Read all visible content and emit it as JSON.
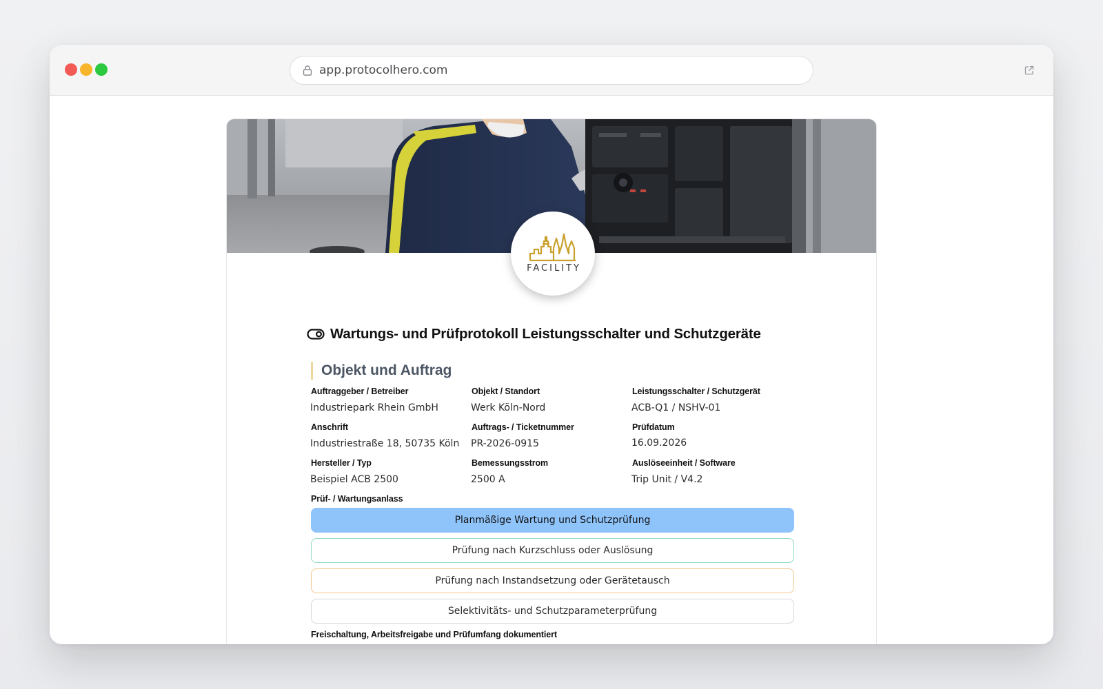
{
  "browser": {
    "url": "app.protocolhero.com"
  },
  "logo": {
    "text": "FACILITY",
    "brand_color": "#c9a02c"
  },
  "document": {
    "title": "Wartungs- und Prüfprotokoll Leistungsschalter und Schutzgeräte"
  },
  "section": {
    "title": "Objekt und Auftrag",
    "accent_color": "#ecd7a1",
    "fields": [
      {
        "label": "Auftraggeber / Betreiber",
        "value": "Industriepark Rhein GmbH"
      },
      {
        "label": "Objekt / Standort",
        "value": "Werk Köln-Nord"
      },
      {
        "label": "Leistungsschalter / Schutzgerät",
        "value": "ACB-Q1 / NSHV-01"
      },
      {
        "label": "Anschrift",
        "value": "Industriestraße 18, 50735 Köln"
      },
      {
        "label": "Auftrags- / Ticketnummer",
        "value": "PR-2026-0915"
      },
      {
        "label": "Prüfdatum",
        "value": "16.09.2026"
      },
      {
        "label": "Hersteller / Typ",
        "value": "Beispiel ACB 2500"
      },
      {
        "label": "Bemessungsstrom",
        "value": "2500 A"
      },
      {
        "label": "Auslöseeinheit / Software",
        "value": "Trip Unit / V4.2"
      }
    ],
    "reason": {
      "label": "Prüf- / Wartungsanlass",
      "options": [
        {
          "label": "Planmäßige Wartung und Schutzprüfung",
          "selected": true
        },
        {
          "label": "Prüfung nach Kurzschluss oder Auslösung",
          "selected": false
        },
        {
          "label": "Prüfung nach Instandsetzung oder Gerätetausch",
          "selected": false
        },
        {
          "label": "Selektivitäts- und Schutzparameterprüfung",
          "selected": false
        }
      ],
      "selected_color": "#8fc4fb"
    },
    "next_label": "Freischaltung, Arbeitsfreigabe und Prüfumfang dokumentiert"
  }
}
